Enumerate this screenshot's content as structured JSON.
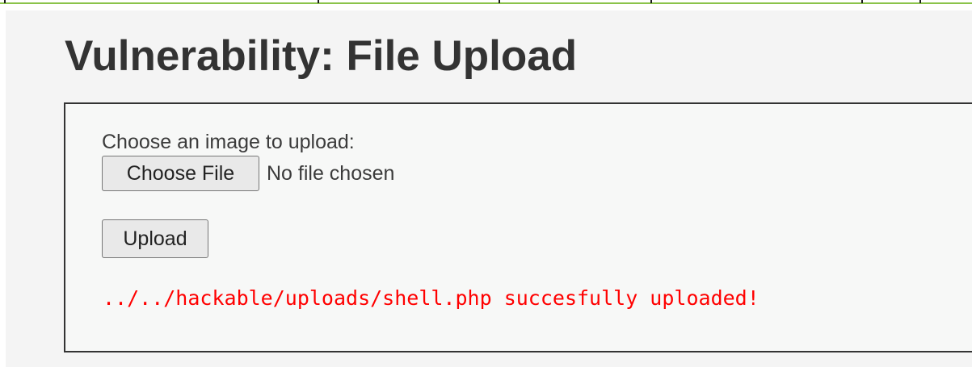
{
  "page": {
    "title": "Vulnerability: File Upload"
  },
  "upload_form": {
    "choose_label": "Choose an image to upload:",
    "choose_file_label": "Choose File",
    "no_file_text": "No file chosen",
    "upload_label": "Upload",
    "result_message": "../../hackable/uploads/shell.php succesfully uploaded!"
  },
  "colors": {
    "title_text": "#333333",
    "panel_background": "#f4f4f4",
    "form_background": "#f7f8f7",
    "border": "#333333",
    "success_message": "#ff0000",
    "top_accent": "#8bc34a"
  }
}
